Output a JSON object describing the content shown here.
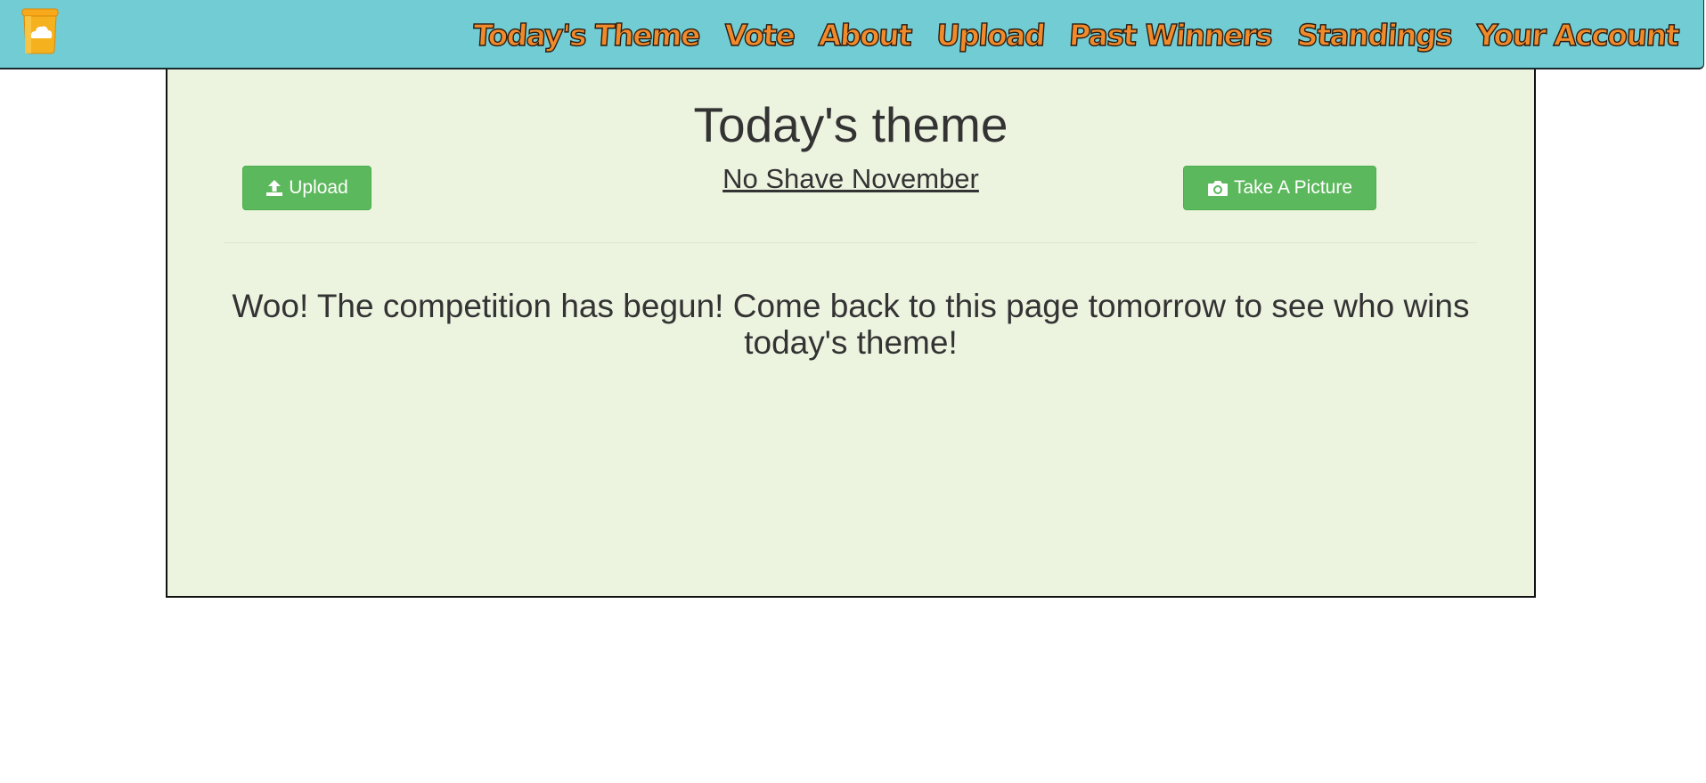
{
  "navbar": {
    "logo_icon": "honey-pot-cloud-logo",
    "items": [
      {
        "label": "Today's Theme"
      },
      {
        "label": "Vote"
      },
      {
        "label": "About"
      },
      {
        "label": "Upload"
      },
      {
        "label": "Past Winners"
      },
      {
        "label": "Standings"
      },
      {
        "label": "Your Account"
      }
    ],
    "colors": {
      "background": "#71ccd4",
      "item_text": "#f08a2a",
      "item_outline": "#2a1a10"
    }
  },
  "panel": {
    "title": "Today's theme",
    "theme_name": "No Shave November",
    "upload_button": {
      "label": "Upload",
      "icon": "upload-icon"
    },
    "picture_button": {
      "label": "Take A Picture",
      "icon": "camera-icon"
    },
    "message": "Woo! The competition has begun! Come back to this page tomorrow to see who wins today's theme!",
    "colors": {
      "background": "#ecf4e0",
      "button": "#5cb85c",
      "text": "#333333"
    }
  }
}
